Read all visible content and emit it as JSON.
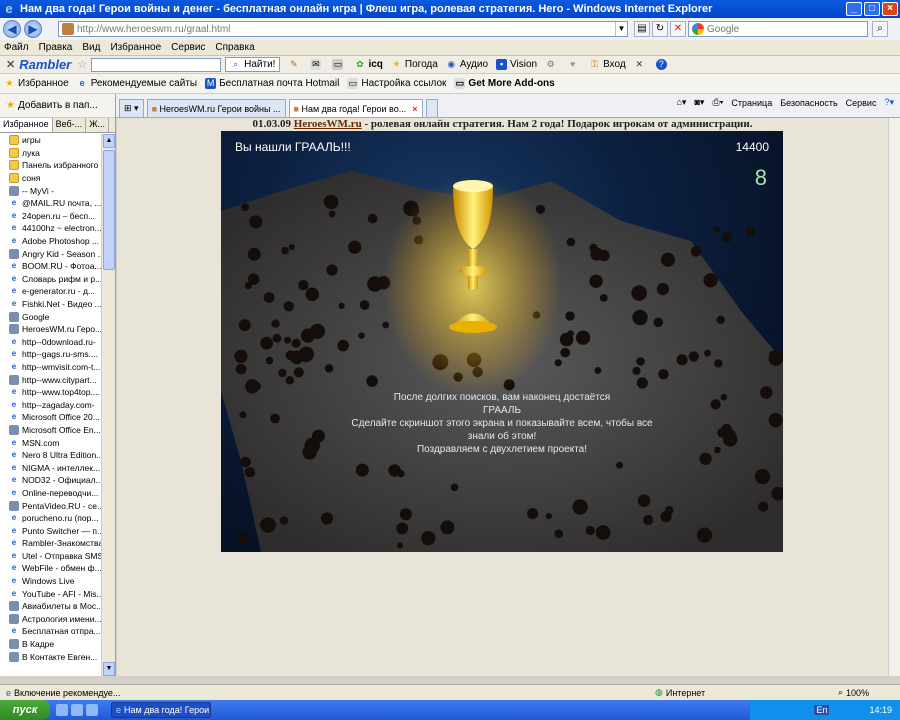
{
  "window": {
    "title": "Нам два года! Герои войны и денег - бесплатная онлайн игра | Флеш игра, ролевая стратегия. Hero - Windows Internet Explorer"
  },
  "address": {
    "url": "http://www.heroeswm.ru/graal.html",
    "search_placeholder": "Google"
  },
  "menu": [
    "Файл",
    "Правка",
    "Вид",
    "Избранное",
    "Сервис",
    "Справка"
  ],
  "rambler": {
    "logo": "Rambler",
    "find_label": "Найти!",
    "weather": "Погода",
    "audio": "Аудио",
    "vision": "Vision",
    "login": "Вход",
    "icq": "icq"
  },
  "favbar": {
    "favorites": "Избранное",
    "items": [
      "Рекомендуемые сайты",
      "Бесплатная почта Hotmail",
      "Настройка ссылок",
      "Get More Add-ons"
    ]
  },
  "sidebar": {
    "add_label": "Добавить в пап...",
    "tabs": [
      "Избранное",
      "Веб-...",
      "Ж..."
    ],
    "items": [
      {
        "label": "игры",
        "icon": "folder"
      },
      {
        "label": "лука",
        "icon": "folder"
      },
      {
        "label": "Панель избранного",
        "icon": "folder"
      },
      {
        "label": "соня",
        "icon": "folder"
      },
      {
        "label": "-- MyVi -",
        "icon": "misc"
      },
      {
        "label": "@MAIL.RU почта, ...",
        "icon": "ie"
      },
      {
        "label": "24open.ru – бесп...",
        "icon": "ie"
      },
      {
        "label": "44100hz ~ electron...",
        "icon": "ie"
      },
      {
        "label": "Adobe Photoshop ...",
        "icon": "ie"
      },
      {
        "label": "Angry Kid - Season ...",
        "icon": "misc"
      },
      {
        "label": "BOOM.RU - Фотоа...",
        "icon": "ie"
      },
      {
        "label": "Словарь рифм и р...",
        "icon": "ie"
      },
      {
        "label": "e-generator.ru - д...",
        "icon": "ie"
      },
      {
        "label": "Fishki.Net - Видео ...",
        "icon": "ie"
      },
      {
        "label": "Google",
        "icon": "misc"
      },
      {
        "label": "HeroesWM.ru Геро...",
        "icon": "misc"
      },
      {
        "label": "http--0download.ru-",
        "icon": "ie"
      },
      {
        "label": "http--gags.ru-sms....",
        "icon": "ie"
      },
      {
        "label": "http--wmvisit.com-t...",
        "icon": "ie"
      },
      {
        "label": "http--www.citypart...",
        "icon": "misc"
      },
      {
        "label": "http--www.top4top....",
        "icon": "ie"
      },
      {
        "label": "http--zagaday.com-",
        "icon": "ie"
      },
      {
        "label": "Microsoft Office 20...",
        "icon": "ie"
      },
      {
        "label": "Microsoft Office En...",
        "icon": "misc"
      },
      {
        "label": "MSN.com",
        "icon": "ie"
      },
      {
        "label": "Nero 8 Ultra Edition...",
        "icon": "ie"
      },
      {
        "label": "NIGMA - интеллек...",
        "icon": "ie"
      },
      {
        "label": "NOD32 - Официал...",
        "icon": "ie"
      },
      {
        "label": "Online-переводчи...",
        "icon": "ie"
      },
      {
        "label": "PentaVideo.RU - се...",
        "icon": "misc"
      },
      {
        "label": "poruchenо.ru (пор...",
        "icon": "ie"
      },
      {
        "label": "Punto Switcher — п...",
        "icon": "ie"
      },
      {
        "label": "Rambler-Знакомства",
        "icon": "ie"
      },
      {
        "label": "Utel - Отправка SMS",
        "icon": "ie"
      },
      {
        "label": "WebFile - обмен ф...",
        "icon": "ie"
      },
      {
        "label": "Windows Live",
        "icon": "ie"
      },
      {
        "label": "YouTube - AFI - Mis...",
        "icon": "ie"
      },
      {
        "label": "Авиабилеты в Мос...",
        "icon": "misc"
      },
      {
        "label": "Астрология имени...",
        "icon": "misc"
      },
      {
        "label": "Бесплатная отпра...",
        "icon": "ie"
      },
      {
        "label": "В Кадре",
        "icon": "misc"
      },
      {
        "label": "В Контакте  Евген...",
        "icon": "misc"
      }
    ]
  },
  "tabs": [
    {
      "label": "HeroesWM.ru Герои войны ..."
    },
    {
      "label": "Нам два года! Герои во..."
    }
  ],
  "commandbar": [
    "Страница",
    "Безопасность",
    "Сервис"
  ],
  "page": {
    "banner_date": "01.03.09",
    "banner_site": "HeroesWM.ru",
    "banner_rest": " - ролевая онлайн стратегия. Нам 2 года! Подарок игрокам от администрации.",
    "game_found": "Вы нашли ГРААЛЬ!!!",
    "game_score": "14400",
    "game_counter": "8",
    "game_msg_1": "После долгих поисков, вам наконец достаётся",
    "game_msg_2": "ГРААЛЬ",
    "game_msg_3": "Сделайте скриншот этого экрана и показывайте всем, чтобы все",
    "game_msg_4": "знали об этом!",
    "game_msg_5": "Поздравляем с двухлетием проекта!"
  },
  "status": {
    "left": "Включение рекомендуе...",
    "zone": "Интернет",
    "zoom": "100%"
  },
  "taskbar": {
    "start": "пуск",
    "task": "Нам два года! Герои ...",
    "lang": "En",
    "time": "14:19"
  }
}
